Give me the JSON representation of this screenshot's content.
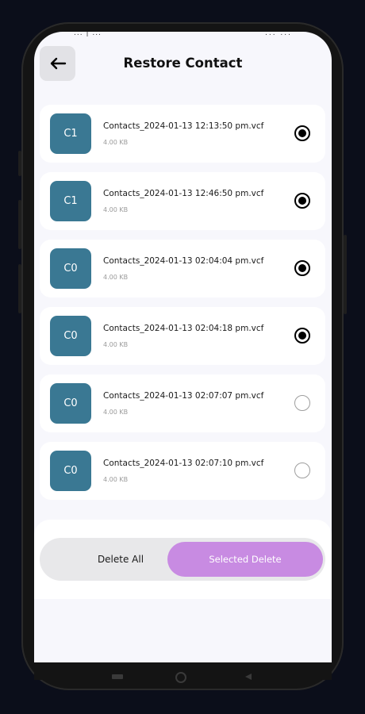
{
  "status_bar": {
    "left": "... | ... ",
    "right": "... ..."
  },
  "header": {
    "title": "Restore Contact",
    "back_icon": "arrow-left-icon"
  },
  "files": [
    {
      "avatar": "C1",
      "name": "Contacts_2024-01-13 12:13:50 pm.vcf",
      "size": "4.00 KB",
      "selected": true
    },
    {
      "avatar": "C1",
      "name": "Contacts_2024-01-13 12:46:50 pm.vcf",
      "size": "4.00 KB",
      "selected": true
    },
    {
      "avatar": "C0",
      "name": "Contacts_2024-01-13 02:04:04 pm.vcf",
      "size": "4.00 KB",
      "selected": true
    },
    {
      "avatar": "C0",
      "name": "Contacts_2024-01-13 02:04:18 pm.vcf",
      "size": "4.00 KB",
      "selected": true
    },
    {
      "avatar": "C0",
      "name": "Contacts_2024-01-13 02:07:07 pm.vcf",
      "size": "4.00 KB",
      "selected": false
    },
    {
      "avatar": "C0",
      "name": "Contacts_2024-01-13 02:07:10 pm.vcf",
      "size": "4.00 KB",
      "selected": false
    }
  ],
  "actions": {
    "delete_all": "Delete All",
    "selected_delete": "Selected Delete"
  },
  "colors": {
    "avatar": "#3a7893",
    "accent": "#c88be2",
    "background": "#f7f7fc"
  }
}
